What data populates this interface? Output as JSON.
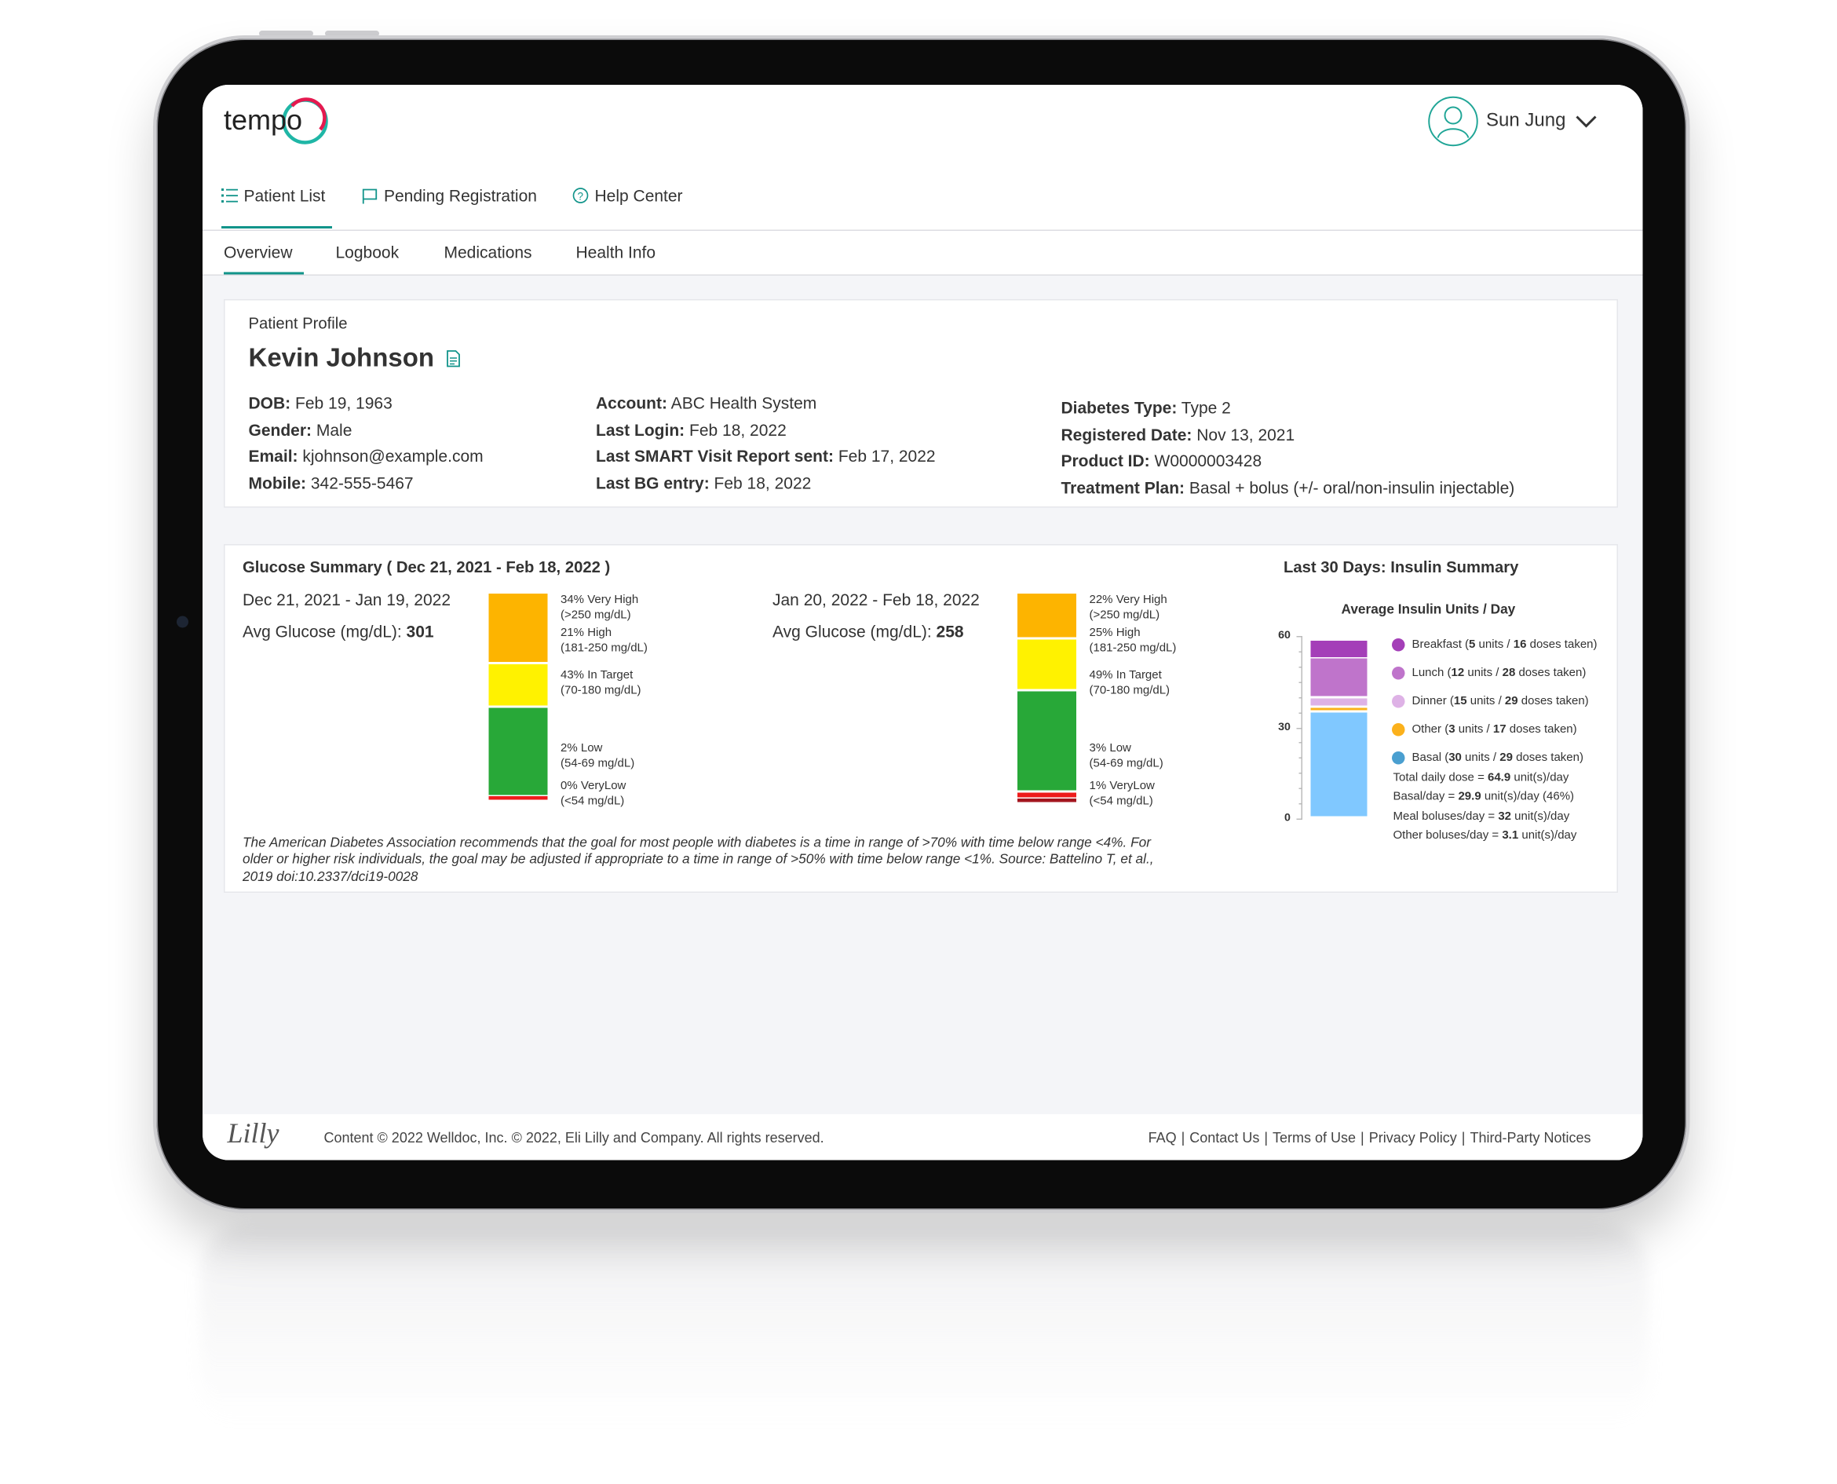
{
  "app": {
    "logo_text": "tempo",
    "brand_colors": {
      "teal": "#1fb6a6",
      "pink": "#e5194f"
    }
  },
  "user": {
    "name": "Sun Jung",
    "icon": "user-circle-icon",
    "menu_icon": "chevron-down-icon"
  },
  "nav": [
    {
      "label": "Patient List",
      "icon": "list-icon",
      "active": true
    },
    {
      "label": "Pending Registration",
      "icon": "flag-icon"
    },
    {
      "label": "Help Center",
      "icon": "help-circle-icon"
    }
  ],
  "tabs": [
    {
      "label": "Overview",
      "active": true
    },
    {
      "label": "Logbook"
    },
    {
      "label": "Medications"
    },
    {
      "label": "Health Info"
    }
  ],
  "profile": {
    "heading": "Patient Profile",
    "name": "Kevin Johnson",
    "name_icon": "document-icon",
    "col1": [
      {
        "k": "DOB:",
        "v": " Feb 19, 1963"
      },
      {
        "k": "Gender:",
        "v": " Male"
      },
      {
        "k": "Email:",
        "v": " kjohnson@example.com"
      },
      {
        "k": "Mobile:",
        "v": " 342-555-5467"
      }
    ],
    "col2": [
      {
        "k": "Account:",
        "v": " ABC Health System"
      },
      {
        "k": "Last Login:",
        "v": " Feb 18, 2022"
      },
      {
        "k": "Last SMART Visit Report sent:",
        "v": " Feb 17, 2022"
      },
      {
        "k": "Last BG entry:",
        "v": " Feb 18, 2022"
      }
    ],
    "col3": [
      {
        "k": "Diabetes Type:",
        "v": " Type 2"
      },
      {
        "k": "Registered Date:",
        "v": " Nov 13, 2021"
      },
      {
        "k": "Product ID:",
        "v": " W0000003428"
      },
      {
        "k": "Treatment Plan:",
        "v": " Basal + bolus (+/- oral/non-insulin injectable)"
      }
    ]
  },
  "glucose": {
    "title": "Glucose Summary ( Dec 21, 2021 - Feb 18, 2022 )",
    "avg_label": "Avg Glucose (mg/dL): ",
    "colors": {
      "very_high": "#fdb400",
      "high": "#fff200",
      "target": "#28a838",
      "low": "#ee1c1c",
      "very_low": "#a3161f"
    },
    "periods": [
      {
        "range": "Dec 21, 2021 - Jan 19, 2022",
        "avg": "301",
        "segments": [
          {
            "key": "very_high",
            "pct": 34,
            "label": "34% Very High",
            "range": "(>250 mg/dL)"
          },
          {
            "key": "high",
            "pct": 21,
            "label": "21% High",
            "range": "(181-250 mg/dL)"
          },
          {
            "key": "target",
            "pct": 43,
            "label": "43% In Target",
            "range": "(70-180 mg/dL)"
          },
          {
            "key": "low",
            "pct": 2,
            "label": "2% Low",
            "range": "(54-69 mg/dL)"
          },
          {
            "key": "very_low",
            "pct": 0,
            "label": "0% VeryLow",
            "range": "(<54 mg/dL)"
          }
        ]
      },
      {
        "range": "Jan 20, 2022 - Feb 18, 2022",
        "avg": "258",
        "segments": [
          {
            "key": "very_high",
            "pct": 22,
            "label": "22% Very High",
            "range": "(>250 mg/dL)"
          },
          {
            "key": "high",
            "pct": 25,
            "label": "25% High",
            "range": "(181-250 mg/dL)"
          },
          {
            "key": "target",
            "pct": 49,
            "label": "49% In Target",
            "range": "(70-180 mg/dL)"
          },
          {
            "key": "low",
            "pct": 3,
            "label": "3% Low",
            "range": "(54-69 mg/dL)"
          },
          {
            "key": "very_low",
            "pct": 1,
            "label": "1% VeryLow",
            "range": "(<54 mg/dL)"
          }
        ]
      }
    ],
    "footnote": "The American Diabetes Association recommends that the goal for most people with diabetes is a time in range of >70% with time below range <4%. For older or higher risk individuals, the goal may be adjusted if appropriate to a time in range of >50% with time below range <1%. Source: Battelino T, et al., 2019 doi:10.2337/dci19-0028"
  },
  "chart_data": {
    "type": "bar",
    "stacked": true,
    "title": "Average Insulin Units / Day",
    "ylim": [
      0,
      60
    ],
    "yticks": [
      "0",
      "30",
      "60"
    ],
    "series": [
      {
        "name": "Basal",
        "value": 35,
        "color": "#80c8ff",
        "legend_color": "#4a9fd0",
        "units": "30",
        "doses": "29"
      },
      {
        "name": "Other",
        "value": 1.5,
        "color": "#fbb11c",
        "legend_color": "#fbb11c",
        "units": "3",
        "doses": "17"
      },
      {
        "name": "Dinner",
        "value": 3,
        "color": "#deb2e6",
        "legend_color": "#deb2e6",
        "units": "15",
        "doses": "29"
      },
      {
        "name": "Lunch",
        "value": 13,
        "color": "#bf74cb",
        "legend_color": "#bf74cb",
        "units": "12",
        "doses": "28"
      },
      {
        "name": "Breakfast",
        "value": 6,
        "color": "#a43fb8",
        "legend_color": "#a43fb8",
        "units": "5",
        "doses": "16"
      }
    ]
  },
  "insulin": {
    "title": "Last 30 Days: Insulin Summary",
    "legend_order": [
      "Breakfast",
      "Lunch",
      "Dinner",
      "Other",
      "Basal"
    ],
    "summary": [
      {
        "pre": "Total daily dose = ",
        "val": "64.9",
        "post": " unit(s)/day"
      },
      {
        "pre": "Basal/day = ",
        "val": "29.9",
        "post": " unit(s)/day (46%)"
      },
      {
        "pre": "Meal boluses/day = ",
        "val": "32",
        "post": " unit(s)/day"
      },
      {
        "pre": "Other boluses/day = ",
        "val": "3.1",
        "post": " unit(s)/day"
      }
    ]
  },
  "footer": {
    "logo": "Lilly",
    "copyright": "Content © 2022 Welldoc, Inc. © 2022, Eli Lilly and Company. All rights reserved.",
    "links": [
      "FAQ",
      "Contact Us",
      "Terms of Use",
      "Privacy Policy",
      "Third-Party Notices"
    ]
  }
}
